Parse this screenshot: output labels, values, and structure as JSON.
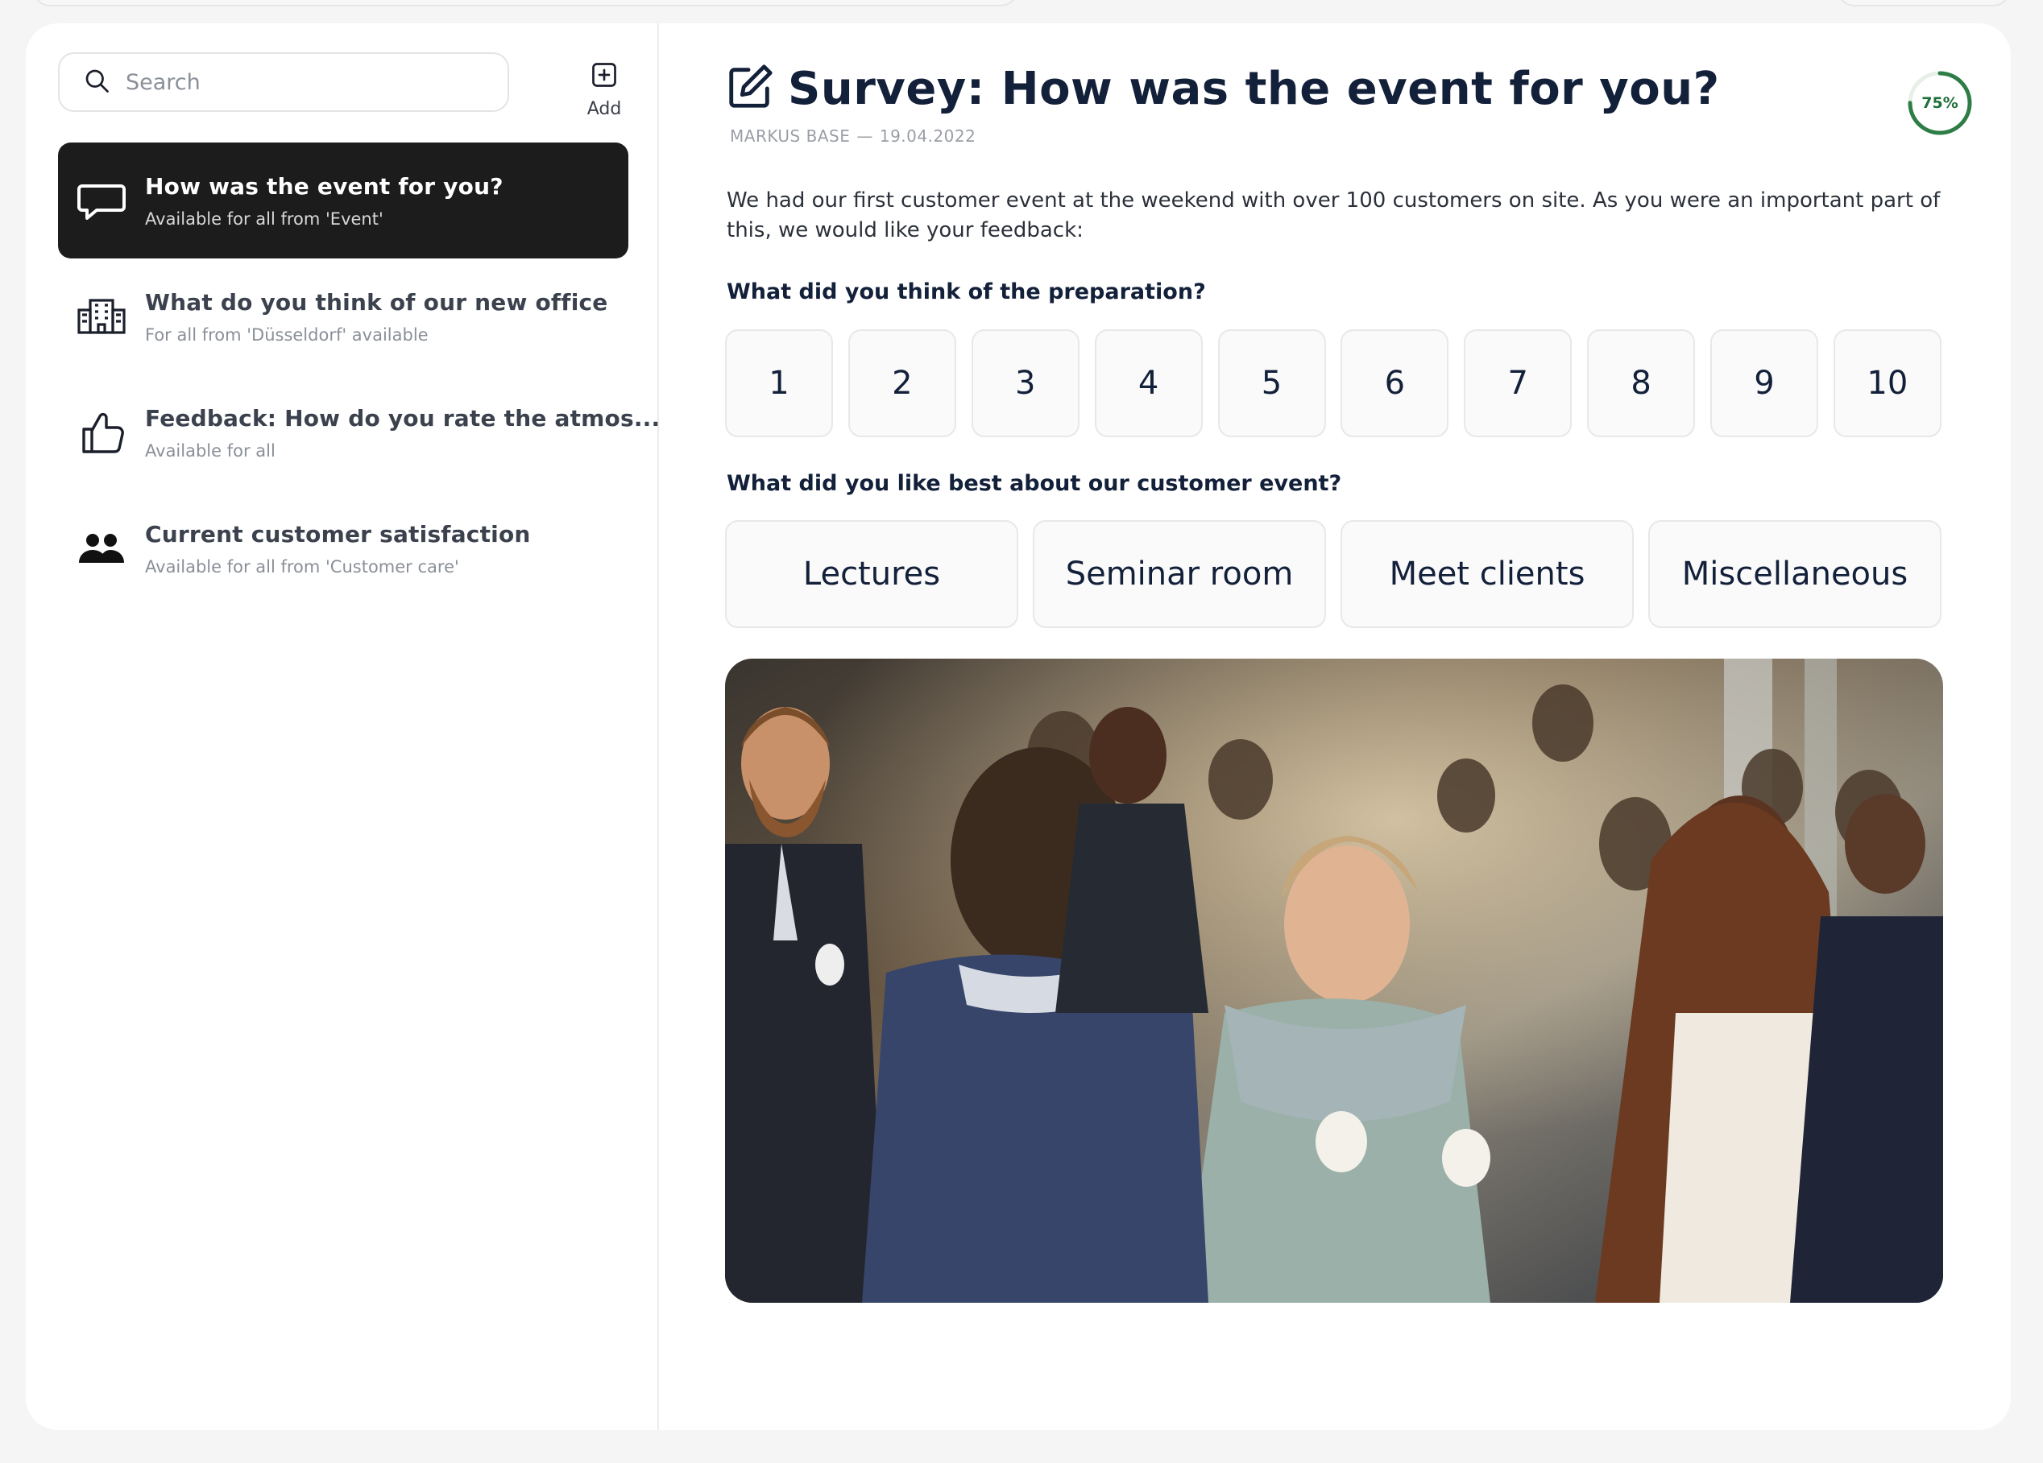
{
  "sidebar": {
    "search_placeholder": "Search",
    "add_label": "Add",
    "items": [
      {
        "title": "How was the event for you?",
        "subtitle": "Available for all from 'Event'",
        "icon": "chat-bubble-icon",
        "active": true
      },
      {
        "title": "What do you think of our new office",
        "subtitle": "For all from 'Düsseldorf' available",
        "icon": "office-building-icon",
        "active": false
      },
      {
        "title": "Feedback: How do you rate the atmos...",
        "subtitle": "Available for all",
        "icon": "thumbs-up-icon",
        "active": false
      },
      {
        "title": "Current customer satisfaction",
        "subtitle": "Available for all from 'Customer care'",
        "icon": "people-icon",
        "active": false
      }
    ]
  },
  "survey": {
    "title": "Survey: How was the event for you?",
    "author": "MARKUS BASE",
    "separator": "—",
    "date": "19.04.2022",
    "progress_label": "75%",
    "progress_value": 0.75,
    "description": "We had our first customer event at the weekend with over 100 customers on site. As you were an important part of this, we would like your feedback:",
    "question1": "What did you think of the preparation?",
    "ratings": [
      "1",
      "2",
      "3",
      "4",
      "5",
      "6",
      "7",
      "8",
      "9",
      "10"
    ],
    "question2": "What did you like best about our customer event?",
    "options": [
      "Lectures",
      "Seminar room",
      "Meet clients",
      "Miscellaneous"
    ]
  },
  "colors": {
    "active_item_bg": "#1c1c1c",
    "progress_ring": "#2e7d46",
    "title_text": "#13203a"
  },
  "icons": [
    "search-icon",
    "add-icon",
    "edit-icon",
    "chat-bubble-icon",
    "office-building-icon",
    "thumbs-up-icon",
    "people-icon"
  ]
}
